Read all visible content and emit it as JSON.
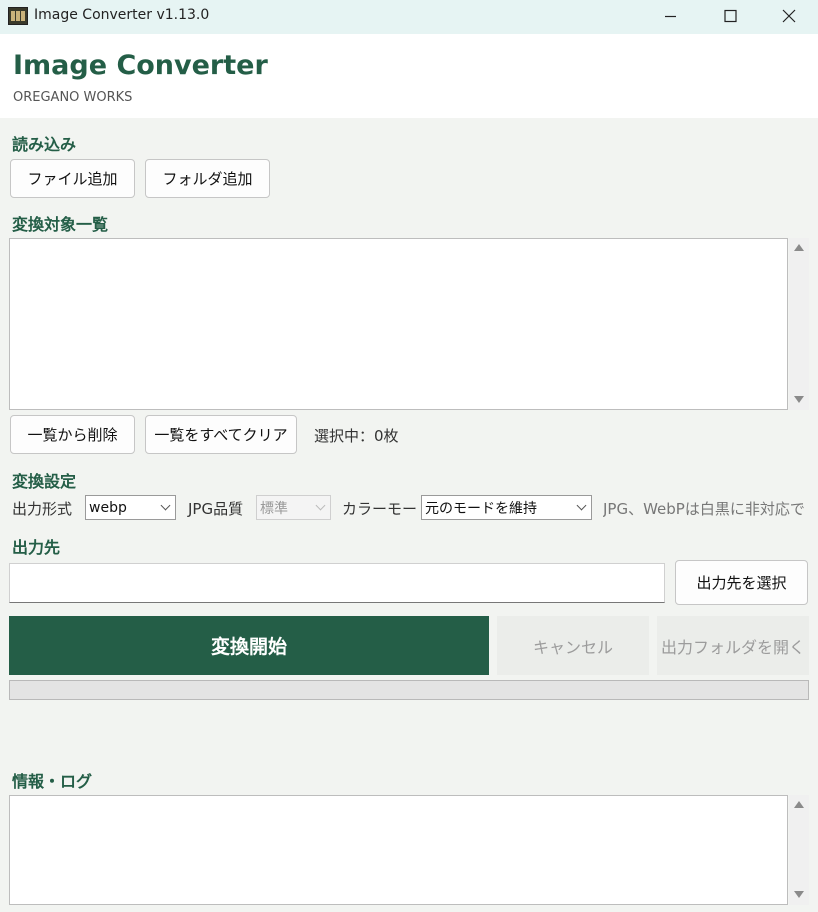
{
  "window": {
    "title": "Image Converter v1.13.0"
  },
  "header": {
    "app_name": "Image Converter",
    "company": "OREGANO WORKS"
  },
  "import": {
    "section_label": "読み込み",
    "add_file_label": "ファイル追加",
    "add_folder_label": "フォルダ追加"
  },
  "list": {
    "section_label": "変換対象一覧",
    "items": [],
    "remove_label": "一覧から削除",
    "clear_label": "一覧をすべてクリア",
    "selection_status": "選択中：0枚"
  },
  "settings": {
    "section_label": "変換設定",
    "format_label": "出力形式",
    "format_value": "webp",
    "quality_label": "JPG品質",
    "quality_value": "標準",
    "color_mode_label": "カラーモード",
    "color_mode_value": "元のモードを維持",
    "note": "JPG、WebPは白黒に非対応で"
  },
  "output": {
    "section_label": "出力先",
    "path_value": "",
    "select_label": "出力先を選択"
  },
  "actions": {
    "start_label": "変換開始",
    "cancel_label": "キャンセル",
    "open_folder_label": "出力フォルダを開く"
  },
  "progress": {
    "value": 0
  },
  "log": {
    "section_label": "情報・ログ",
    "text": ""
  },
  "colors": {
    "accent": "#245e47",
    "titlebar": "#e6f4f3",
    "background": "#f2f4f1"
  }
}
